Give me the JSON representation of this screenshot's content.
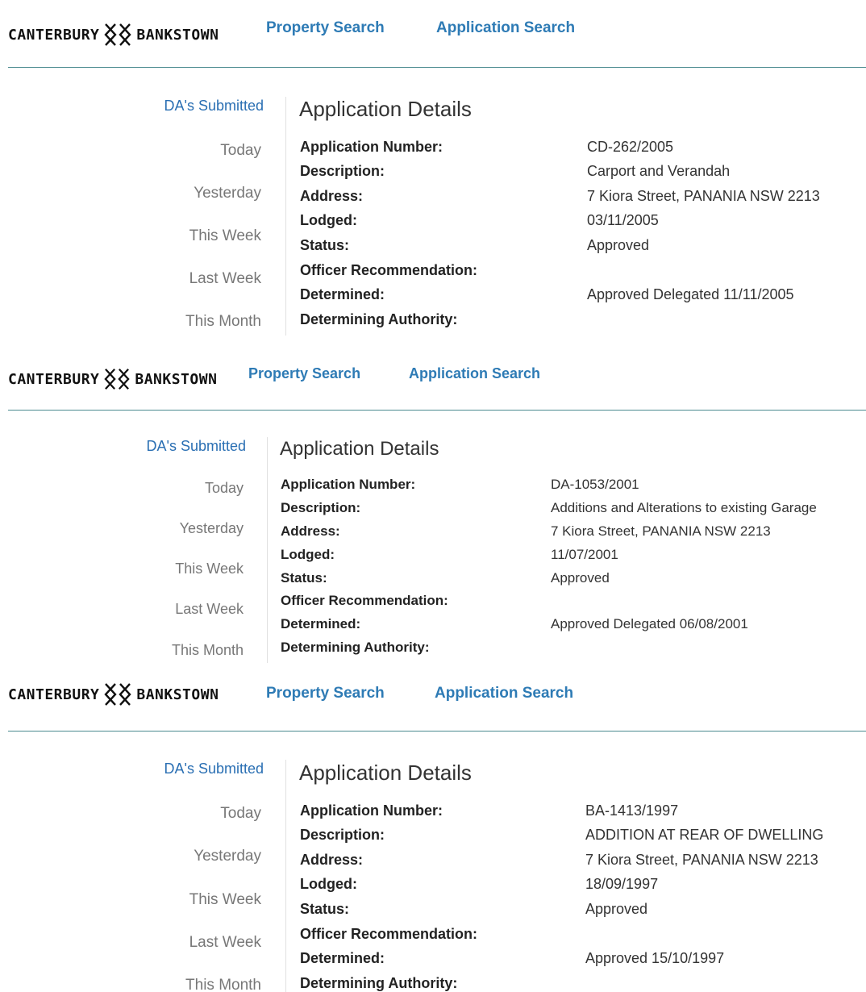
{
  "brand": {
    "left": "CANTERBURY",
    "right": "BANKSTOWN"
  },
  "nav": {
    "property_search": "Property Search",
    "application_search": "Application Search"
  },
  "sidebar": {
    "title": "DA's Submitted",
    "items": [
      "Today",
      "Yesterday",
      "This Week",
      "Last Week",
      "This Month"
    ]
  },
  "details_title": "Application Details",
  "field_labels": {
    "number": "Application Number:",
    "description": "Description:",
    "address": "Address:",
    "lodged": "Lodged:",
    "status": "Status:",
    "officer": "Officer Recommendation:",
    "determined": "Determined:",
    "authority": "Determining Authority:"
  },
  "applications": [
    {
      "number": "CD-262/2005",
      "description": "Carport and Verandah",
      "address": "7 Kiora Street, PANANIA NSW 2213",
      "lodged": "03/11/2005",
      "status": "Approved",
      "officer": "",
      "determined": "Approved Delegated 11/11/2005",
      "authority": ""
    },
    {
      "number": "DA-1053/2001",
      "description": "Additions and Alterations to existing Garage",
      "address": "7 Kiora Street, PANANIA NSW 2213",
      "lodged": "11/07/2001",
      "status": "Approved",
      "officer": "",
      "determined": "Approved Delegated 06/08/2001",
      "authority": ""
    },
    {
      "number": "BA-1413/1997",
      "description": "ADDITION AT REAR OF DWELLING",
      "address": "7 Kiora Street, PANANIA NSW 2213",
      "lodged": "18/09/1997",
      "status": "Approved",
      "officer": "",
      "determined": "Approved 15/10/1997",
      "authority": ""
    }
  ]
}
